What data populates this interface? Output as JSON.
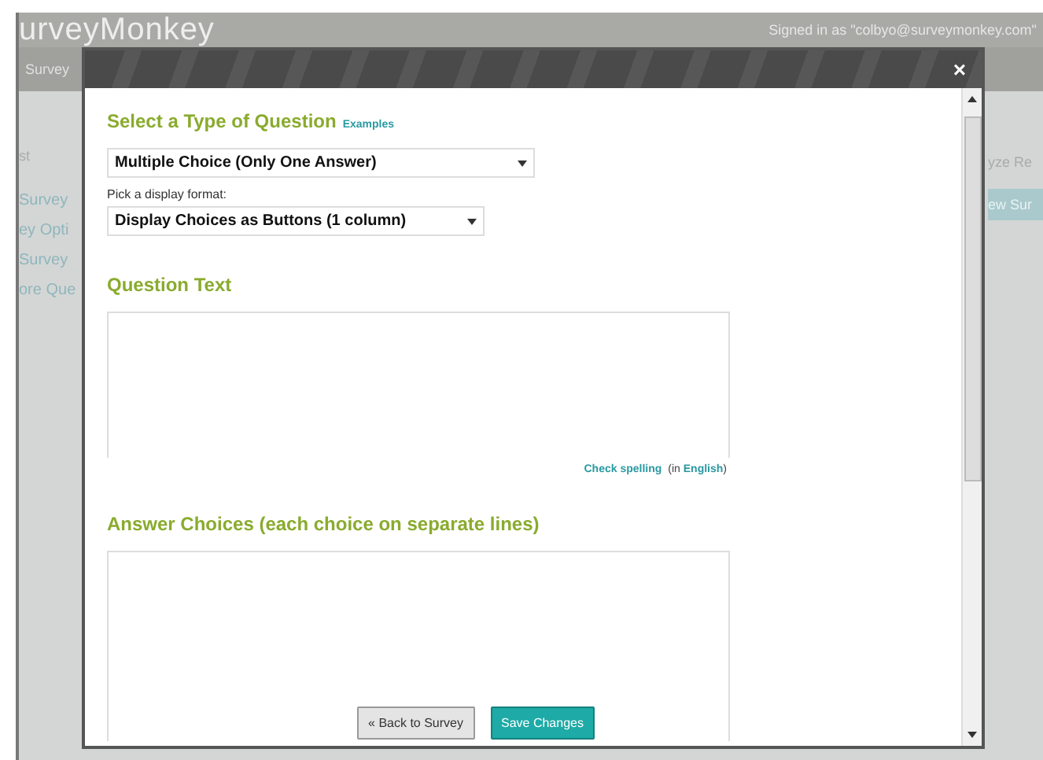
{
  "background": {
    "logo": "urveyMonkey",
    "signed_in": "Signed in as \"colbyo@surveymonkey.com\"",
    "nav_tab": "Survey",
    "side_heading": "st",
    "side_items": [
      "Survey",
      "ey Opti",
      "Survey",
      "ore Que"
    ],
    "right_tab": "yze Re",
    "right_button": "ew Sur"
  },
  "dialog": {
    "close": "×",
    "type_heading": "Select a Type of Question",
    "examples_link": "Examples",
    "question_type": "Multiple Choice (Only One Answer)",
    "format_label": "Pick a display format:",
    "display_format": "Display Choices as Buttons (1 column)",
    "question_heading": "Question Text",
    "spell": {
      "link": "Check spelling",
      "open": "(in ",
      "language": "English",
      "close": ")"
    },
    "answers_heading": "Answer Choices (each choice on separate lines)",
    "buttons": [
      {
        "kind": "secondary",
        "label": "« Back to Survey"
      },
      {
        "kind": "primary",
        "label": "Save Changes"
      }
    ]
  }
}
